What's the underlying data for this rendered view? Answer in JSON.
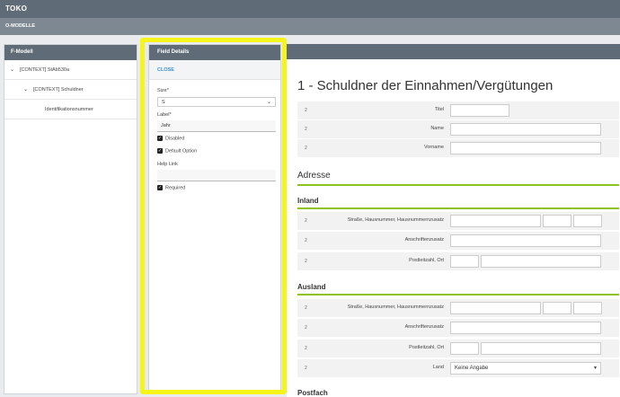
{
  "app": {
    "title": "TOKO",
    "breadcrumb": "O-MODELLE"
  },
  "tree": {
    "header": "F-Modell",
    "items": [
      {
        "label": "[CONTEXT] StAb530a",
        "chevron": "v"
      },
      {
        "label": "[CONTEXT] Schuldner",
        "chevron": "v"
      },
      {
        "label": "Identifikationsnummer",
        "chevron": ""
      }
    ]
  },
  "details": {
    "header": "Field Details",
    "close_label": "CLOSE",
    "size_label": "Size*",
    "size_value": "S",
    "label_label": "Label*",
    "label_value": "Jahr",
    "disabled_label": "Disabled",
    "default_option_label": "Default Option",
    "help_link_label": "Help Link",
    "help_link_value": "",
    "required_label": "Required",
    "checkbox_mark": "✓"
  },
  "form": {
    "title": "1 - Schuldner der Einnahmen/Vergütungen",
    "row_number": "2",
    "rows_top": [
      "Titel",
      "Name",
      "Vorname"
    ],
    "section_adresse": "Adresse",
    "section_inland": "Inland",
    "inland_rows": [
      "Straße, Hausnummer, Hausnummernzusatz",
      "Anschriftenzusatz",
      "Postleitzahl, Ort"
    ],
    "section_ausland": "Ausland",
    "ausland_rows": [
      "Straße, Hausnummer, Hausnummernzusatz",
      "Anschriftenzusatz",
      "Postleitzahl, Ort",
      "Land"
    ],
    "land_value": "Keine Angabe",
    "next_section": "Postfach"
  }
}
